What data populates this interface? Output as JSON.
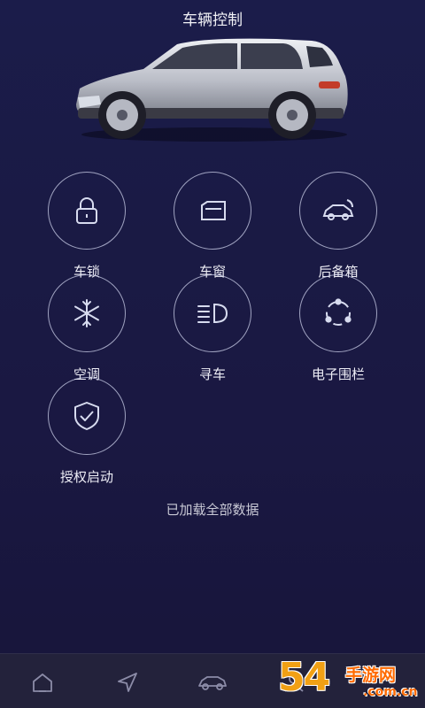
{
  "header": {
    "title": "车辆控制"
  },
  "controls": [
    {
      "label": "车锁",
      "icon": "lock-icon"
    },
    {
      "label": "车窗",
      "icon": "window-icon"
    },
    {
      "label": "后备箱",
      "icon": "trunk-icon"
    },
    {
      "label": "空调",
      "icon": "snowflake-icon"
    },
    {
      "label": "寻车",
      "icon": "headlight-icon"
    },
    {
      "label": "电子围栏",
      "icon": "geofence-icon"
    },
    {
      "label": "授权启动",
      "icon": "shield-check-icon"
    }
  ],
  "status": {
    "text": "已加载全部数据"
  },
  "tabbar": {
    "items": [
      {
        "icon": "home-icon"
      },
      {
        "icon": "navigation-icon"
      },
      {
        "icon": "car-icon"
      },
      {
        "icon": "user-icon"
      }
    ]
  },
  "watermark": {
    "number": "54",
    "brand": "手游网",
    "url": ".com.cn"
  },
  "colors": {
    "background": "#1a1a44",
    "accent": "#cdd2eb",
    "tabbar": "#23223b"
  }
}
